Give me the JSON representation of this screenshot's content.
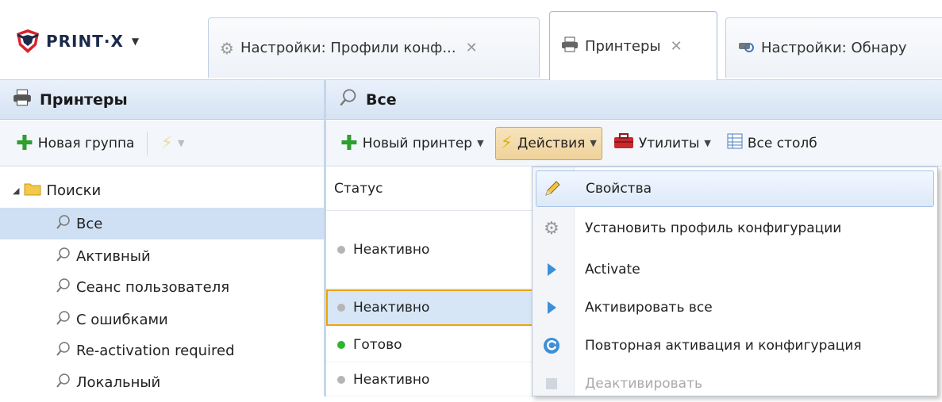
{
  "brand": {
    "name": "PRINT·X"
  },
  "tabs": [
    {
      "label": "Настройки: Профили конф...",
      "closable": true
    },
    {
      "label": "Принтеры",
      "closable": true
    },
    {
      "label": "Настройки: Обнару",
      "closable": false
    }
  ],
  "close_glyph": "✕",
  "left_panel": {
    "title": "Принтеры",
    "toolbar": {
      "new_group": "Новая группа"
    },
    "tree": {
      "root": "Поиски",
      "items": [
        "Все",
        "Активный",
        "Сеанс пользователя",
        "С ошибками",
        "Re-activation required",
        "Локальный"
      ]
    }
  },
  "right_panel": {
    "title": "Все",
    "toolbar": {
      "new_printer": "Новый принтер",
      "actions": "Действия",
      "utilities": "Утилиты",
      "columns": "Все столб"
    },
    "grid": {
      "column_header": "Статус",
      "rows": [
        {
          "status": "Неактивно",
          "color": "#b5b5b5"
        },
        {
          "status": "Неактивно",
          "color": "#b5b5b5"
        },
        {
          "status": "Готово",
          "color": "#2fb52f"
        },
        {
          "status": "Неактивно",
          "color": "#b5b5b5"
        }
      ]
    }
  },
  "actions_menu": {
    "items": [
      {
        "label": "Свойства",
        "icon": "pencil-icon",
        "disabled": false
      },
      {
        "label": "Установить профиль конфигурации",
        "icon": "gear-icon",
        "disabled": false
      },
      {
        "label": "Activate",
        "icon": "play-icon",
        "disabled": false
      },
      {
        "label": "Активировать все",
        "icon": "play-icon",
        "disabled": false
      },
      {
        "label": "Повторная активация и конфигурация",
        "icon": "refresh-icon",
        "disabled": false
      },
      {
        "label": "Деактивировать",
        "icon": "stop-icon",
        "disabled": true
      }
    ]
  },
  "colors": {
    "accent": "#f0a400",
    "selection": "#cfe0f5",
    "header": "#d5e3f4"
  }
}
